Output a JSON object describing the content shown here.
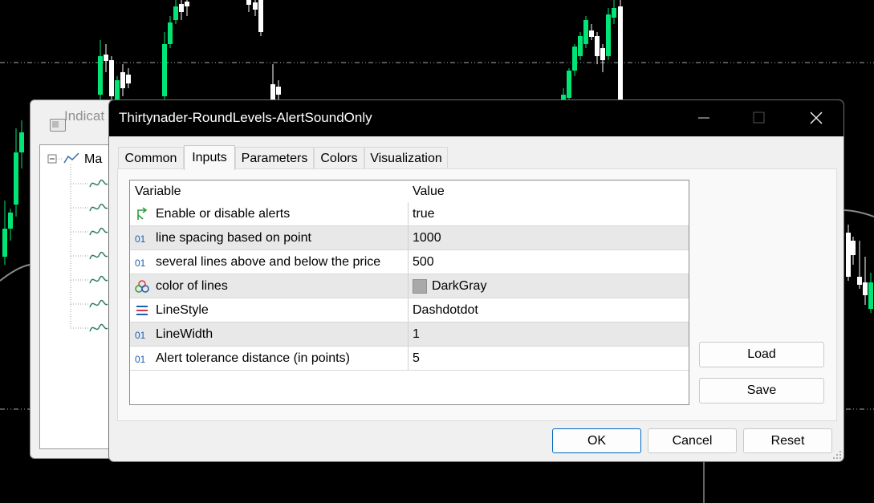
{
  "background": {
    "bg_window_title": "Indicat",
    "tree_root_label": "Ma",
    "tree_children_count_visible": 7
  },
  "dialog": {
    "title": "Thirtynader-RoundLevels-AlertSoundOnly",
    "tabs": [
      {
        "label": "Common",
        "active": false
      },
      {
        "label": "Inputs",
        "active": true
      },
      {
        "label": "Parameters",
        "active": false
      },
      {
        "label": "Colors",
        "active": false
      },
      {
        "label": "Visualization",
        "active": false
      }
    ],
    "grid": {
      "headers": {
        "variable": "Variable",
        "value": "Value"
      },
      "rows": [
        {
          "icon": "bool-arrow-icon",
          "variable": "Enable or disable alerts",
          "value": "true"
        },
        {
          "icon": "int-icon",
          "variable": "line spacing based on point",
          "value": "1000"
        },
        {
          "icon": "int-icon",
          "variable": "several lines above and below the price",
          "value": "500"
        },
        {
          "icon": "color-icon",
          "variable": "color of lines",
          "value": "DarkGray",
          "swatch": "#a9a9a9"
        },
        {
          "icon": "linestyle-icon",
          "variable": "LineStyle",
          "value": "Dashdotdot"
        },
        {
          "icon": "int-icon",
          "variable": "LineWidth",
          "value": "1"
        },
        {
          "icon": "int-icon",
          "variable": "Alert tolerance distance (in points)",
          "value": "5"
        }
      ]
    },
    "buttons": {
      "load": "Load",
      "save": "Save",
      "ok": "OK",
      "cancel": "Cancel",
      "reset": "Reset"
    }
  },
  "colors": {
    "bull_candle": "#00e676",
    "bear_candle": "#ffffff",
    "chart_bg": "#000000",
    "ok_border": "#0067c0"
  }
}
